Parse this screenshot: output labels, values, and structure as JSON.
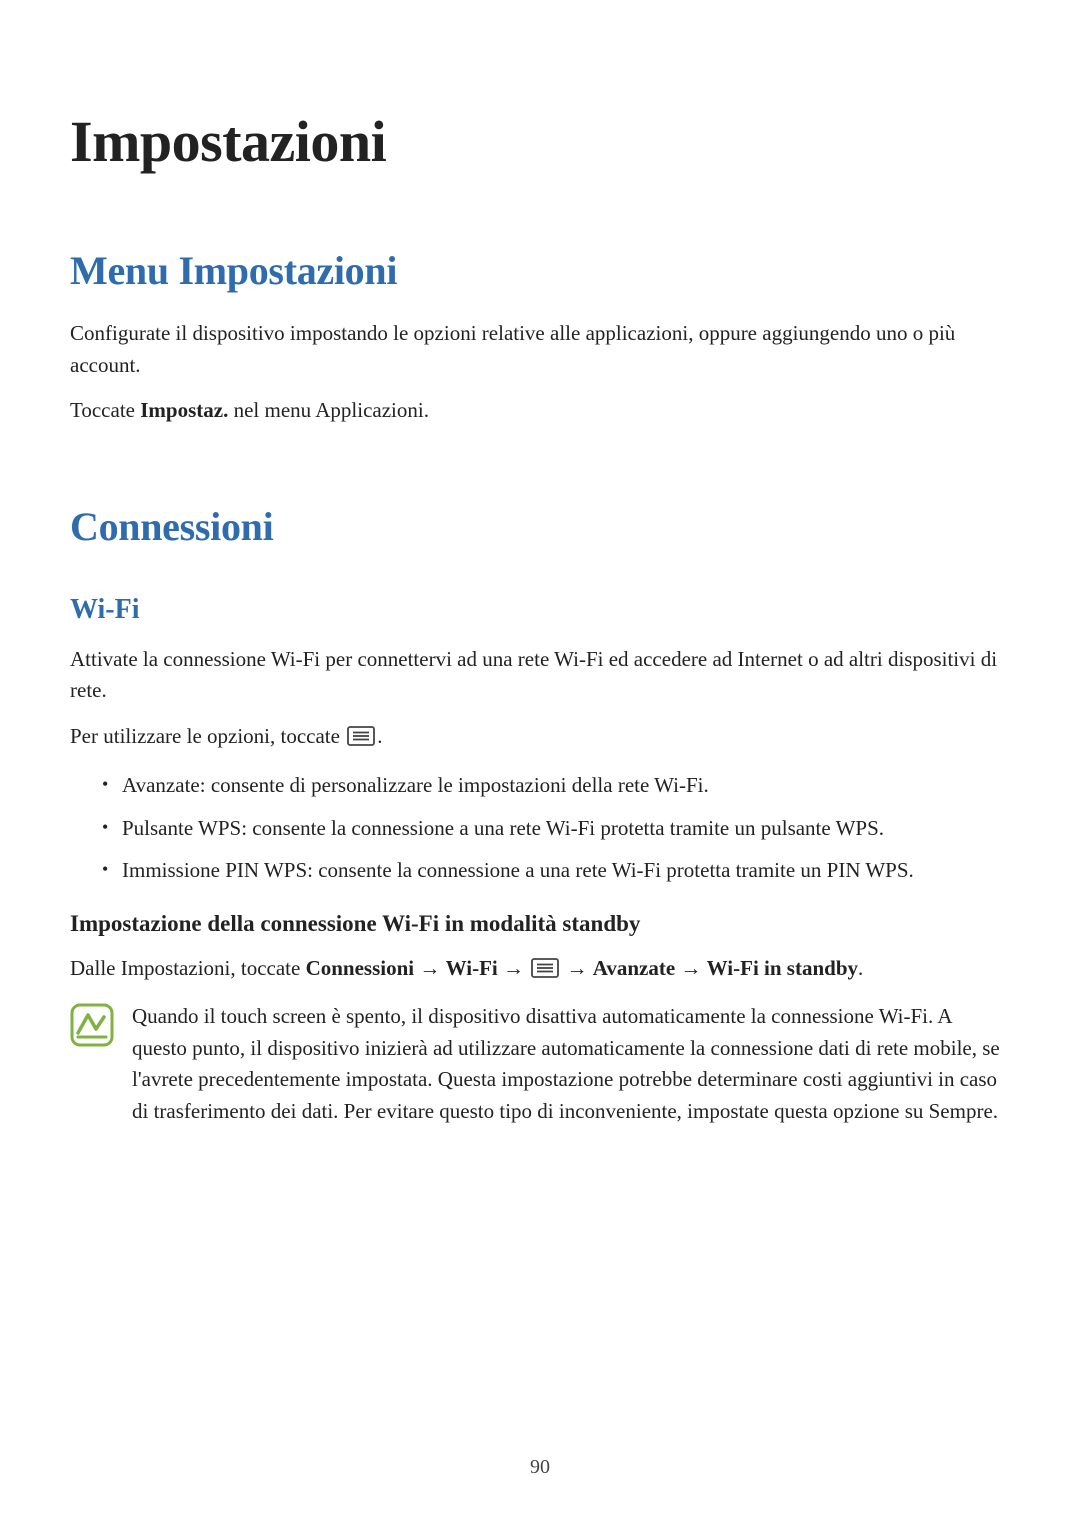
{
  "chapter": {
    "title": "Impostazioni"
  },
  "sections": {
    "menu": {
      "title": "Menu Impostazioni",
      "p1": "Configurate il dispositivo impostando le opzioni relative alle applicazioni, oppure aggiungendo uno o più account.",
      "p2_prefix": "Toccate ",
      "p2_bold": "Impostaz.",
      "p2_suffix": " nel menu Applicazioni."
    },
    "connections": {
      "title": "Connessioni",
      "wifi": {
        "title": "Wi-Fi",
        "p1": "Attivate la connessione Wi-Fi per connettervi ad una rete Wi-Fi ed accedere ad Internet o ad altri dispositivi di rete.",
        "p2_prefix": "Per utilizzare le opzioni, toccate ",
        "p2_suffix": ".",
        "bullets": [
          {
            "bold": "Avanzate",
            "text": ": consente di personalizzare le impostazioni della rete Wi-Fi."
          },
          {
            "bold": "Pulsante WPS",
            "text": ": consente la connessione a una rete Wi-Fi protetta tramite un pulsante WPS."
          },
          {
            "bold": "Immissione PIN WPS",
            "text": ": consente la connessione a una rete Wi-Fi protetta tramite un PIN WPS."
          }
        ],
        "standby": {
          "heading": "Impostazione della connessione Wi-Fi in modalità standby",
          "path_prefix": "Dalle Impostazioni, toccate ",
          "path_b1": "Connessioni",
          "arrow": " → ",
          "path_b2": "Wi-Fi",
          "path_b3": "Avanzate",
          "path_b4": "Wi-Fi in standby",
          "path_suffix": ".",
          "note_prefix": "Quando il touch screen è spento, il dispositivo disattiva automaticamente la connessione Wi-Fi. A questo punto, il dispositivo inizierà ad utilizzare automaticamente la connessione dati di rete mobile, se l'avrete precedentemente impostata. Questa impostazione potrebbe determinare costi aggiuntivi in caso di trasferimento dei dati. Per evitare questo tipo di inconveniente, impostate questa opzione su ",
          "note_bold": "Sempre",
          "note_suffix": "."
        }
      }
    }
  },
  "page_number": "90"
}
